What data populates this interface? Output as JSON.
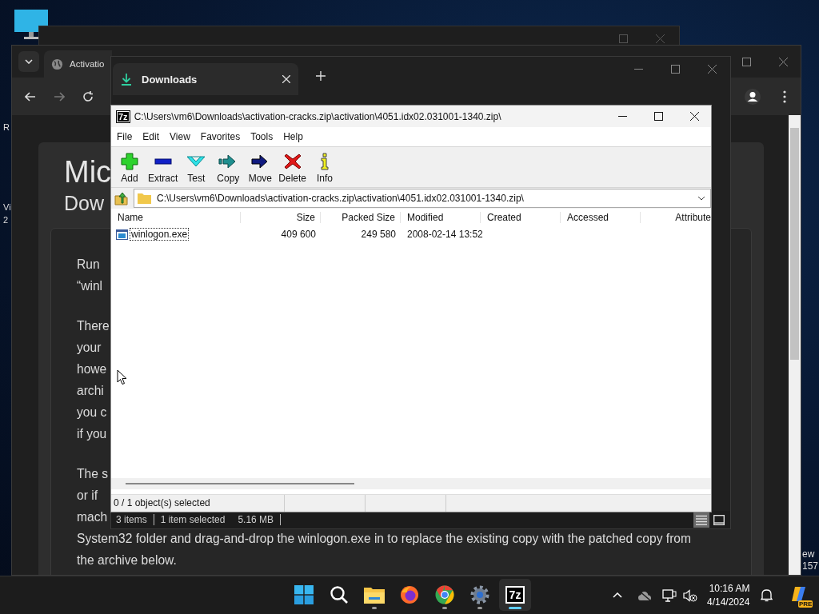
{
  "desktop": {
    "left_labels": [
      "R",
      "Vi",
      "2"
    ],
    "right_labels": [
      "ew",
      "157"
    ]
  },
  "browser": {
    "tab": "Activatio",
    "page": {
      "heading": "Mic",
      "subheading": "Dow",
      "paragraphs": [
        [
          "Run",
          "“winl"
        ],
        [
          "There",
          "your",
          "howe",
          "archi",
          "you c",
          "if you"
        ],
        [
          "The s",
          "or if",
          "mach",
          "System32 folder and drag-and-drop the winlogon.exe in to replace the existing copy with the patched copy from",
          "the archive below."
        ]
      ]
    }
  },
  "downloads_window": {
    "tab": "Downloads",
    "status": [
      "3 items",
      "1 item selected",
      "5.16 MB"
    ],
    "views": [
      {
        "kind": "details",
        "selected": true
      },
      {
        "kind": "icons",
        "selected": false
      }
    ]
  },
  "archive_window": {
    "logo": "7z",
    "title": "C:\\Users\\vm6\\Downloads\\activation-cracks.zip\\activation\\4051.idx02.031001-1340.zip\\",
    "menu": [
      "File",
      "Edit",
      "View",
      "Favorites",
      "Tools",
      "Help"
    ],
    "tools": [
      {
        "kind": "add",
        "label": "Add"
      },
      {
        "kind": "extract",
        "label": "Extract"
      },
      {
        "kind": "test",
        "label": "Test"
      },
      {
        "kind": "copy",
        "label": "Copy"
      },
      {
        "kind": "move",
        "label": "Move"
      },
      {
        "kind": "delete",
        "label": "Delete"
      },
      {
        "kind": "info",
        "label": "Info"
      }
    ],
    "path": "C:\\Users\\vm6\\Downloads\\activation-cracks.zip\\activation\\4051.idx02.031001-1340.zip\\",
    "columns": [
      "Name",
      "Size",
      "Packed Size",
      "Modified",
      "Created",
      "Accessed",
      "Attribute"
    ],
    "rows": [
      {
        "cells": [
          "winlogon.exe",
          "409 600",
          "249 580",
          "2008-02-14 13:52"
        ],
        "focused": true
      }
    ],
    "status": "0 / 1 object(s) selected"
  },
  "taskbar": {
    "apps": [
      {
        "kind": "start",
        "running": false,
        "active": false
      },
      {
        "kind": "search",
        "running": false,
        "active": false
      },
      {
        "kind": "explorer",
        "running": true,
        "active": false
      },
      {
        "kind": "firefox",
        "running": false,
        "active": false
      },
      {
        "kind": "chrome",
        "running": true,
        "active": false
      },
      {
        "kind": "settings",
        "running": true,
        "active": false
      },
      {
        "kind": "archiver",
        "label": "7z",
        "running": true,
        "active": true
      }
    ],
    "clock": {
      "time": "10:16 AM",
      "date": "4/14/2024"
    },
    "badge": "PRE"
  }
}
